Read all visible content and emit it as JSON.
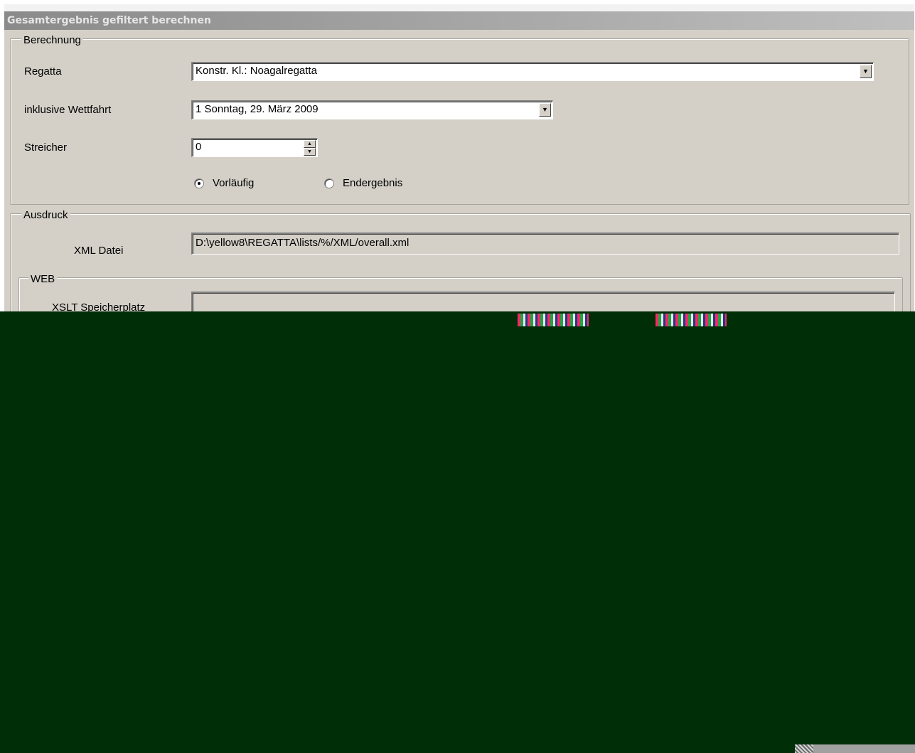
{
  "window": {
    "title": "Gesamtergebnis gefiltert berechnen"
  },
  "berechnung": {
    "legend": "Berechnung",
    "regatta_label": "Regatta",
    "regatta_value": "Konstr. Kl.:   Noagalregatta",
    "wettfahrt_label": "inklusive Wettfahrt",
    "wettfahrt_value": "1  Sonntag, 29. März 2009",
    "streicher_label": "Streicher",
    "streicher_value": "0",
    "radio_vorlaeufig": "Vorläufig",
    "radio_endergebnis": "Endergebnis",
    "selected": "Vorläufig"
  },
  "ausdruck": {
    "legend": "Ausdruck",
    "xml_label": "XML Datei",
    "xml_value": "D:\\yellow8\\REGATTA\\lists/%/XML/overall.xml",
    "web": {
      "legend": "WEB",
      "xslt_label": "XSLT Speicherplatz",
      "xslt_value": ""
    }
  },
  "icons": {
    "dropdown": "chevron-down-icon",
    "spin_up": "arrow-up-icon",
    "spin_down": "arrow-down-icon"
  },
  "colors": {
    "window_bg": "#d4d0c8",
    "overlay": "#002e07"
  }
}
